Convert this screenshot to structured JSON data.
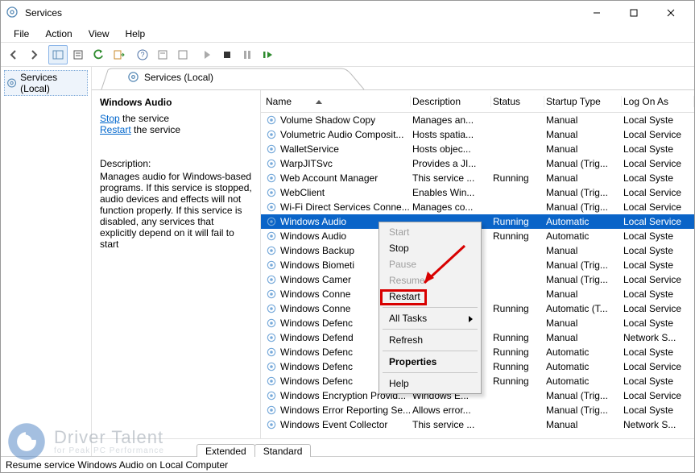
{
  "window_title": "Services",
  "menu": {
    "file": "File",
    "action": "Action",
    "view": "View",
    "help": "Help"
  },
  "left_tree": {
    "root": "Services (Local)"
  },
  "tab_title": "Services (Local)",
  "detail": {
    "selected_title": "Windows Audio",
    "stop_text": "Stop",
    "after_stop": " the service",
    "restart_text": "Restart",
    "after_restart": " the service",
    "desc_label": "Description:",
    "desc_body": "Manages audio for Windows-based programs.  If this service is stopped, audio devices and effects will not function properly.  If this service is disabled, any services that explicitly depend on it will fail to start"
  },
  "columns": {
    "name": "Name",
    "desc": "Description",
    "status": "Status",
    "startup": "Startup Type",
    "logon": "Log On As"
  },
  "rows": [
    {
      "name": "Volume Shadow Copy",
      "desc": "Manages an...",
      "status": "",
      "startup": "Manual",
      "logon": "Local Syste"
    },
    {
      "name": "Volumetric Audio Composit...",
      "desc": "Hosts spatia...",
      "status": "",
      "startup": "Manual",
      "logon": "Local Service"
    },
    {
      "name": "WalletService",
      "desc": "Hosts objec...",
      "status": "",
      "startup": "Manual",
      "logon": "Local Syste"
    },
    {
      "name": "WarpJITSvc",
      "desc": "Provides a JI...",
      "status": "",
      "startup": "Manual (Trig...",
      "logon": "Local Service"
    },
    {
      "name": "Web Account Manager",
      "desc": "This service ...",
      "status": "Running",
      "startup": "Manual",
      "logon": "Local Syste"
    },
    {
      "name": "WebClient",
      "desc": "Enables Win...",
      "status": "",
      "startup": "Manual (Trig...",
      "logon": "Local Service"
    },
    {
      "name": "Wi-Fi Direct Services Conne...",
      "desc": "Manages co...",
      "status": "",
      "startup": "Manual (Trig...",
      "logon": "Local Service"
    },
    {
      "name": "Windows Audio",
      "desc": "",
      "status": "Running",
      "startup": "Automatic",
      "logon": "Local Service",
      "selected": true
    },
    {
      "name": "Windows Audio ",
      "desc": "",
      "status": "Running",
      "startup": "Automatic",
      "logon": "Local Syste"
    },
    {
      "name": "Windows Backup",
      "desc": "",
      "status": "",
      "startup": "Manual",
      "logon": "Local Syste"
    },
    {
      "name": "Windows Biometi",
      "desc": "",
      "status": "",
      "startup": "Manual (Trig...",
      "logon": "Local Syste"
    },
    {
      "name": "Windows Camer",
      "desc": "",
      "status": "",
      "startup": "Manual (Trig...",
      "logon": "Local Service"
    },
    {
      "name": "Windows Conne",
      "desc": "",
      "status": "",
      "startup": "Manual",
      "logon": "Local Syste"
    },
    {
      "name": "Windows Conne",
      "desc": "",
      "status": "Running",
      "startup": "Automatic (T...",
      "logon": "Local Service"
    },
    {
      "name": "Windows Defenc",
      "desc": "",
      "status": "",
      "startup": "Manual",
      "logon": "Local Syste"
    },
    {
      "name": "Windows Defend",
      "desc": "",
      "status": "Running",
      "startup": "Manual",
      "logon": "Network S..."
    },
    {
      "name": "Windows Defenc",
      "desc": "",
      "status": "Running",
      "startup": "Automatic",
      "logon": "Local Syste"
    },
    {
      "name": "Windows Defenc",
      "desc": "",
      "status": "Running",
      "startup": "Automatic",
      "logon": "Local Service"
    },
    {
      "name": "Windows Defenc",
      "desc": "",
      "status": "Running",
      "startup": "Automatic",
      "logon": "Local Syste"
    },
    {
      "name": "Windows Encryption Provid...",
      "desc": "Windows E...",
      "status": "",
      "startup": "Manual (Trig...",
      "logon": "Local Service"
    },
    {
      "name": "Windows Error Reporting Se...",
      "desc": "Allows error...",
      "status": "",
      "startup": "Manual (Trig...",
      "logon": "Local Syste"
    },
    {
      "name": "Windows Event Collector",
      "desc": "This service ...",
      "status": "",
      "startup": "Manual",
      "logon": "Network S..."
    }
  ],
  "context_menu": {
    "start": "Start",
    "stop": "Stop",
    "pause": "Pause",
    "resume": "Resume",
    "restart": "Restart",
    "all_tasks": "All Tasks",
    "refresh": "Refresh",
    "properties": "Properties",
    "help": "Help"
  },
  "bottom_tabs": {
    "extended": "Extended",
    "standard": "Standard"
  },
  "statusbar": "Resume service Windows Audio on Local Computer",
  "watermark": {
    "title": "Driver Talent",
    "sub": "for Peak PC Performance"
  }
}
